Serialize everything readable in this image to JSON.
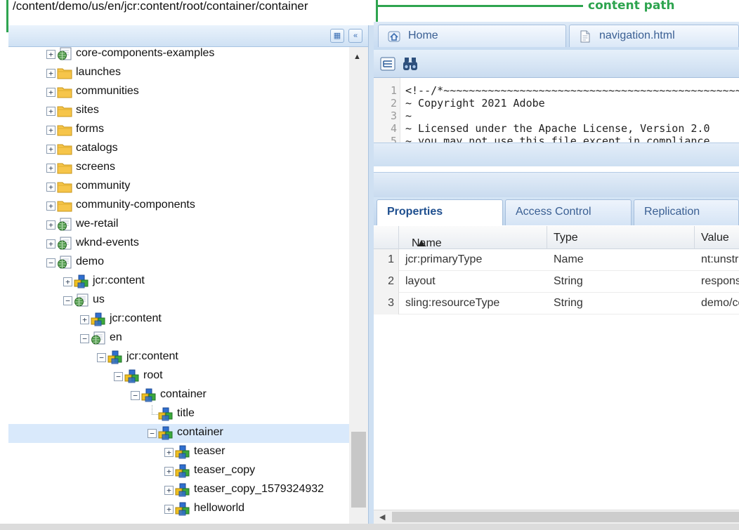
{
  "header": {
    "content_path": "/content/demo/us/en/jcr:content/root/container/container",
    "annotation_label": "content path"
  },
  "tree": {
    "nodes": [
      {
        "label": "core-components-examples",
        "depth": 0,
        "icon": "globe-page-icon",
        "state": "collapsed"
      },
      {
        "label": "launches",
        "depth": 0,
        "icon": "folder-icon",
        "state": "collapsed"
      },
      {
        "label": "communities",
        "depth": 0,
        "icon": "folder-icon",
        "state": "collapsed"
      },
      {
        "label": "sites",
        "depth": 0,
        "icon": "folder-icon",
        "state": "collapsed"
      },
      {
        "label": "forms",
        "depth": 0,
        "icon": "folder-icon",
        "state": "collapsed"
      },
      {
        "label": "catalogs",
        "depth": 0,
        "icon": "folder-icon",
        "state": "collapsed"
      },
      {
        "label": "screens",
        "depth": 0,
        "icon": "folder-icon",
        "state": "collapsed"
      },
      {
        "label": "community",
        "depth": 0,
        "icon": "folder-icon",
        "state": "collapsed"
      },
      {
        "label": "community-components",
        "depth": 0,
        "icon": "folder-icon",
        "state": "collapsed"
      },
      {
        "label": "we-retail",
        "depth": 0,
        "icon": "globe-page-icon",
        "state": "collapsed"
      },
      {
        "label": "wknd-events",
        "depth": 0,
        "icon": "globe-page-icon",
        "state": "collapsed"
      },
      {
        "label": "demo",
        "depth": 0,
        "icon": "globe-page-icon",
        "state": "expanded"
      },
      {
        "label": "jcr:content",
        "depth": 1,
        "icon": "component-node-icon",
        "state": "collapsed"
      },
      {
        "label": "us",
        "depth": 1,
        "icon": "globe-page-icon",
        "state": "expanded"
      },
      {
        "label": "jcr:content",
        "depth": 2,
        "icon": "component-node-icon",
        "state": "collapsed"
      },
      {
        "label": "en",
        "depth": 2,
        "icon": "globe-page-icon",
        "state": "expanded"
      },
      {
        "label": "jcr:content",
        "depth": 3,
        "icon": "component-node-icon",
        "state": "expanded"
      },
      {
        "label": "root",
        "depth": 4,
        "icon": "component-node-icon",
        "state": "expanded"
      },
      {
        "label": "container",
        "depth": 5,
        "icon": "component-node-icon",
        "state": "expanded"
      },
      {
        "label": "title",
        "depth": 6,
        "icon": "component-node-icon",
        "state": "leaf"
      },
      {
        "label": "container",
        "depth": 6,
        "icon": "component-node-icon",
        "state": "expanded",
        "selected": true
      },
      {
        "label": "teaser",
        "depth": 7,
        "icon": "component-node-icon",
        "state": "collapsed"
      },
      {
        "label": "teaser_copy",
        "depth": 7,
        "icon": "component-node-icon",
        "state": "collapsed"
      },
      {
        "label": "teaser_copy_1579324932",
        "depth": 7,
        "icon": "component-node-icon",
        "state": "collapsed"
      },
      {
        "label": "helloworld",
        "depth": 7,
        "icon": "component-node-icon",
        "state": "collapsed"
      }
    ]
  },
  "editor": {
    "tabs": [
      {
        "label": "Home",
        "icon": "home-icon"
      },
      {
        "label": "navigation.html",
        "icon": "file-icon"
      }
    ],
    "toolbar": [
      {
        "name": "tree-view-icon"
      },
      {
        "name": "binoculars-icon"
      }
    ],
    "code_lines": [
      {
        "n": "1",
        "text": "<!--/*~~~~~~~~~~~~~~~~~~~~~~~~~~~~~~~~~~~~~~~~~~~~~~~~~~~~~~~~~~~~"
      },
      {
        "n": "2",
        "text": "  ~ Copyright 2021 Adobe"
      },
      {
        "n": "3",
        "text": "  ~"
      },
      {
        "n": "4",
        "text": "  ~ Licensed under the Apache License, Version 2.0"
      },
      {
        "n": "5",
        "text": "  ~ you may not use this file except in compliance"
      }
    ]
  },
  "properties": {
    "tabs": [
      {
        "label": "Properties",
        "active": true
      },
      {
        "label": "Access Control",
        "active": false
      },
      {
        "label": "Replication",
        "active": false
      }
    ],
    "columns": [
      "Name",
      "Type",
      "Value"
    ],
    "rows": [
      {
        "n": "1",
        "name": "jcr:primaryType",
        "type": "Name",
        "value": "nt:unstructured"
      },
      {
        "n": "2",
        "name": "layout",
        "type": "String",
        "value": "responsiveGrid"
      },
      {
        "n": "3",
        "name": "sling:resourceType",
        "type": "String",
        "value": "demo/components/container"
      }
    ]
  }
}
